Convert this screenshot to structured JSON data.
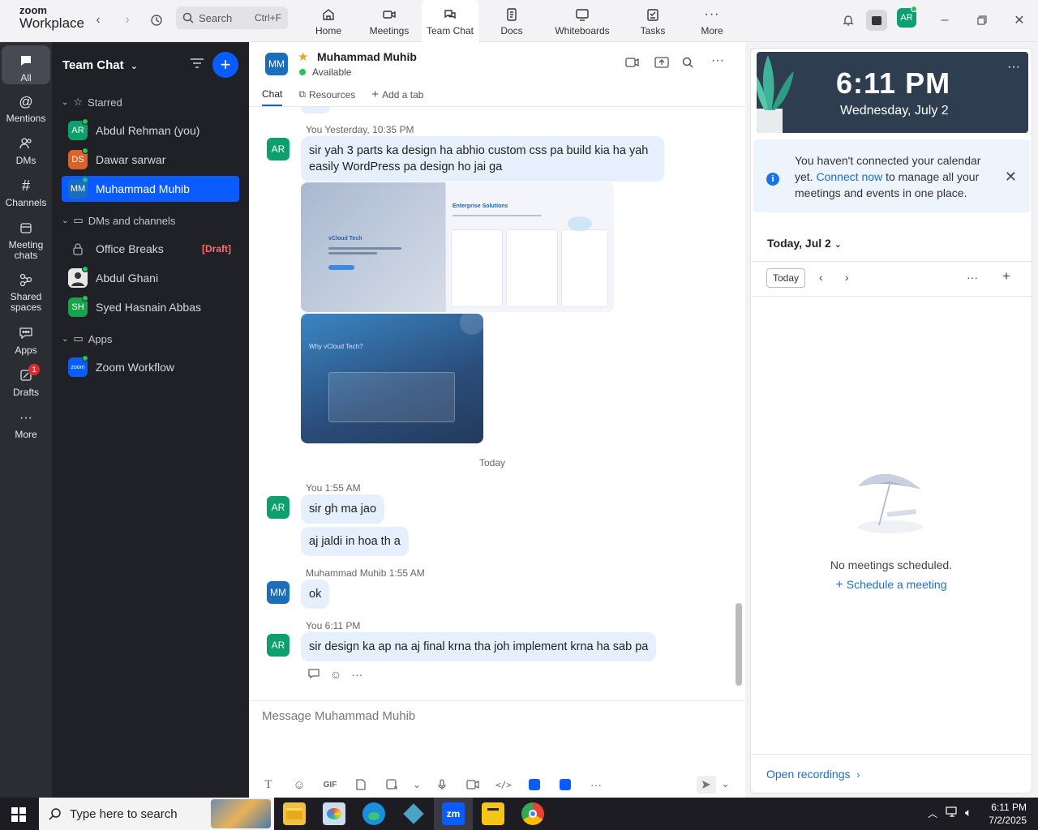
{
  "app": {
    "logo_line1": "zoom",
    "logo_line2": "Workplace",
    "search_label": "Search",
    "search_shortcut": "Ctrl+F",
    "user_initials": "AR",
    "nav": [
      {
        "label": "Home",
        "icon": "home-icon"
      },
      {
        "label": "Meetings",
        "icon": "video-icon"
      },
      {
        "label": "Team Chat",
        "icon": "chat-icon",
        "active": true
      },
      {
        "label": "Docs",
        "icon": "document-icon"
      },
      {
        "label": "Whiteboards",
        "icon": "whiteboard-icon"
      },
      {
        "label": "Tasks",
        "icon": "tasks-icon"
      },
      {
        "label": "More",
        "icon": "more-icon"
      }
    ]
  },
  "rail": {
    "items": [
      {
        "label": "All"
      },
      {
        "label": "Mentions"
      },
      {
        "label": "DMs"
      },
      {
        "label": "Channels"
      },
      {
        "label": "Meeting chats"
      },
      {
        "label": "Shared spaces"
      },
      {
        "label": "Apps"
      },
      {
        "label": "Drafts",
        "badge": "1"
      },
      {
        "label": "More"
      }
    ]
  },
  "sidebar": {
    "title": "Team Chat",
    "starred_label": "Starred",
    "dms_label": "DMs and channels",
    "apps_label": "Apps",
    "starred": [
      {
        "initials": "AR",
        "name": "Abdul Rehman (you)",
        "color": "#0e9f6e"
      },
      {
        "initials": "DS",
        "name": "Dawar sarwar",
        "color": "#d9622b"
      },
      {
        "initials": "MM",
        "name": "Muhammad Muhib",
        "color": "#1a6fbd"
      }
    ],
    "dms": [
      {
        "name": "Office Breaks",
        "draft": "[Draft]"
      },
      {
        "name": "Abdul Ghani"
      },
      {
        "initials": "SH",
        "name": "Syed Hasnain Abbas",
        "color": "#17a34a"
      }
    ],
    "apps": [
      {
        "name": "Zoom Workflow",
        "logo": "zoom"
      }
    ]
  },
  "chat": {
    "contact_initials": "MM",
    "contact_name": "Muhammad Muhib",
    "status": "Available",
    "tabs": [
      "Chat",
      "Resources",
      "Add a tab"
    ],
    "messages": [
      {
        "sender": "You",
        "time": "Yesterday, 10:35 PM",
        "initials": "AR",
        "text": "sir yah 3 parts ka design ha abhio custom css pa build kia ha yah easily WordPress pa design ho jai ga"
      },
      {
        "day_separator": "Today"
      },
      {
        "sender": "You",
        "time": "1:55 AM",
        "initials": "AR",
        "text": "sir gh ma jao"
      },
      {
        "text": "aj jaldi in hoa th a"
      },
      {
        "sender": "Muhammad Muhib",
        "time": "1:55 AM",
        "initials": "MM",
        "text": "ok"
      },
      {
        "sender": "You",
        "time": "6:11 PM",
        "initials": "AR",
        "text": "sir design ka ap na aj final krna tha joh implement krna ha sab pa"
      }
    ],
    "image1": {
      "left_title": "vCloud Tech",
      "right_title": "Enterprise Solutions"
    },
    "image2": {
      "title": "Why vCloud Tech?"
    },
    "composer_placeholder": "Message Muhammad Muhib",
    "composer_gif": "GIF"
  },
  "calendar": {
    "time": "6:11 PM",
    "date": "Wednesday, July 2",
    "notice_pre": "You haven't connected your calendar yet.",
    "notice_link": "Connect now",
    "notice_post": "to manage all your meetings and events in one place.",
    "date_header": "Today, Jul 2",
    "today_button": "Today",
    "empty_text": "No meetings scheduled.",
    "schedule_link": "Schedule a meeting",
    "open_recordings": "Open recordings"
  },
  "taskbar": {
    "search_placeholder": "Type here to search",
    "time": "6:11 PM",
    "date": "7/2/2025",
    "zoom_app_label": "zm"
  }
}
